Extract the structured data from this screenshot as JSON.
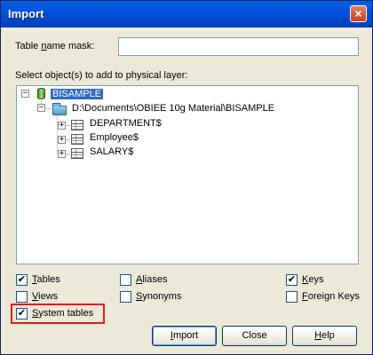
{
  "window": {
    "title": "Import",
    "close_symbol": "×"
  },
  "mask": {
    "label_pre": "Table ",
    "label_u": "n",
    "label_post": "ame mask:",
    "value": ""
  },
  "select_label": "Select object(s) to add to physical layer:",
  "tree": {
    "root": "BISAMPLE",
    "path": "D:\\Documents\\OBIEE 10g Material\\BISAMPLE",
    "tables": [
      "DEPARTMENT$",
      "Employee$",
      "SALARY$"
    ],
    "collapse_symbol": "−",
    "expand_symbol": "+"
  },
  "options": {
    "check_mark": "✔",
    "tables": {
      "label_u": "T",
      "label_rest": "ables",
      "checked": true
    },
    "views": {
      "label_u": "V",
      "label_rest": "iews",
      "checked": false
    },
    "system_tables": {
      "label_u": "S",
      "label_rest": "ystem tables",
      "checked": true
    },
    "aliases": {
      "label_u": "A",
      "label_rest": "liases",
      "checked": false
    },
    "synonyms": {
      "label_u": "S",
      "label_rest": "ynonyms",
      "checked": false
    },
    "keys": {
      "label_u": "K",
      "label_rest": "eys",
      "checked": true
    },
    "foreign_keys": {
      "label_u": "F",
      "label_rest": "oreign Keys",
      "checked": false
    }
  },
  "buttons": {
    "import_u": "I",
    "import_rest": "mport",
    "close": "Close",
    "help_u": "H",
    "help_rest": "elp"
  },
  "highlight_color": "#e21b1b"
}
